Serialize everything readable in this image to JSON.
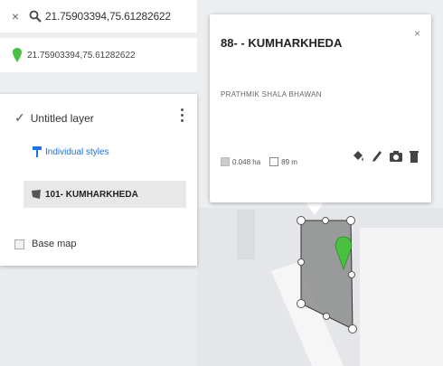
{
  "search": {
    "close_icon": "close-icon",
    "query": "21.75903394,75.61282622"
  },
  "result": {
    "label": "21.75903394,75.61282622"
  },
  "layer": {
    "name": "Untitled layer",
    "styles_link": "Individual styles",
    "feature_label": "101- KUMHARKHEDA",
    "base_map": "Base map"
  },
  "popup": {
    "title": "88- - KUMHARKHEDA",
    "description": "PRATHMIK SHALA BHAWAN",
    "area": "0.048 ha",
    "perimeter": "89 m",
    "close": "×"
  },
  "colors": {
    "accent": "#1a73e8",
    "polygon_fill": "#8c8c8c",
    "marker": "#48c040"
  }
}
